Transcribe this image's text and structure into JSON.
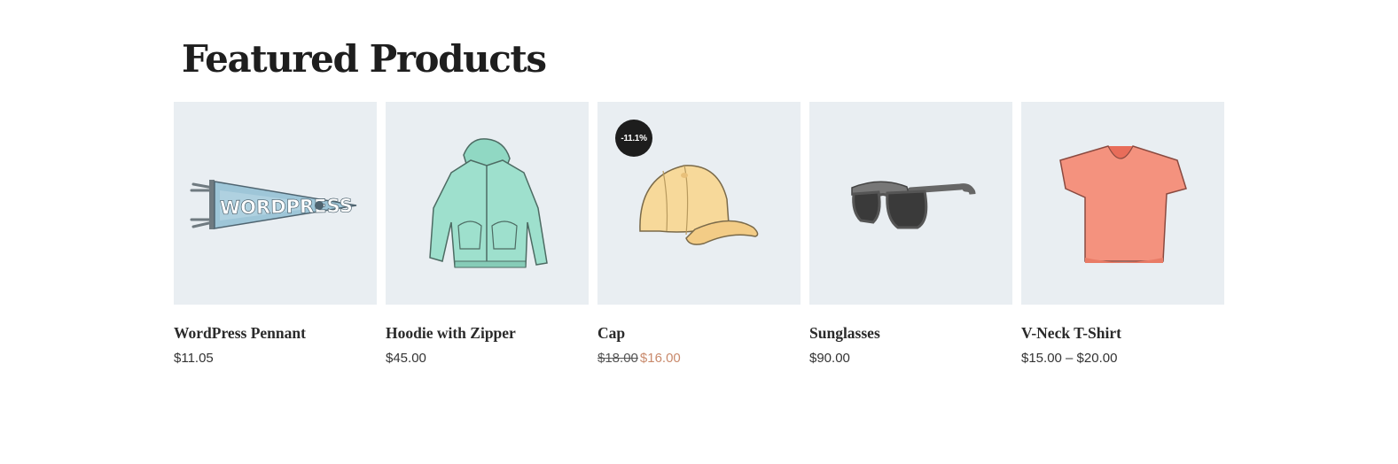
{
  "section": {
    "title": "Featured Products"
  },
  "products": [
    {
      "name": "WordPress Pennant",
      "price": "$11.05",
      "image": "wordpress-pennant-image"
    },
    {
      "name": "Hoodie with Zipper",
      "price": "$45.00",
      "image": "hoodie-zipper-image"
    },
    {
      "name": "Cap",
      "regular_price": "$18.00",
      "sale_price": "$16.00",
      "badge": "-11.1%",
      "image": "cap-image"
    },
    {
      "name": "Sunglasses",
      "price": "$90.00",
      "image": "sunglasses-image"
    },
    {
      "name": "V-Neck T-Shirt",
      "price": "$15.00 – $20.00",
      "image": "vneck-tshirt-image"
    }
  ],
  "colors": {
    "thumb_background": "#e9eef2",
    "badge_background": "#1d1d1d",
    "sale_price": "#c98a6c"
  }
}
